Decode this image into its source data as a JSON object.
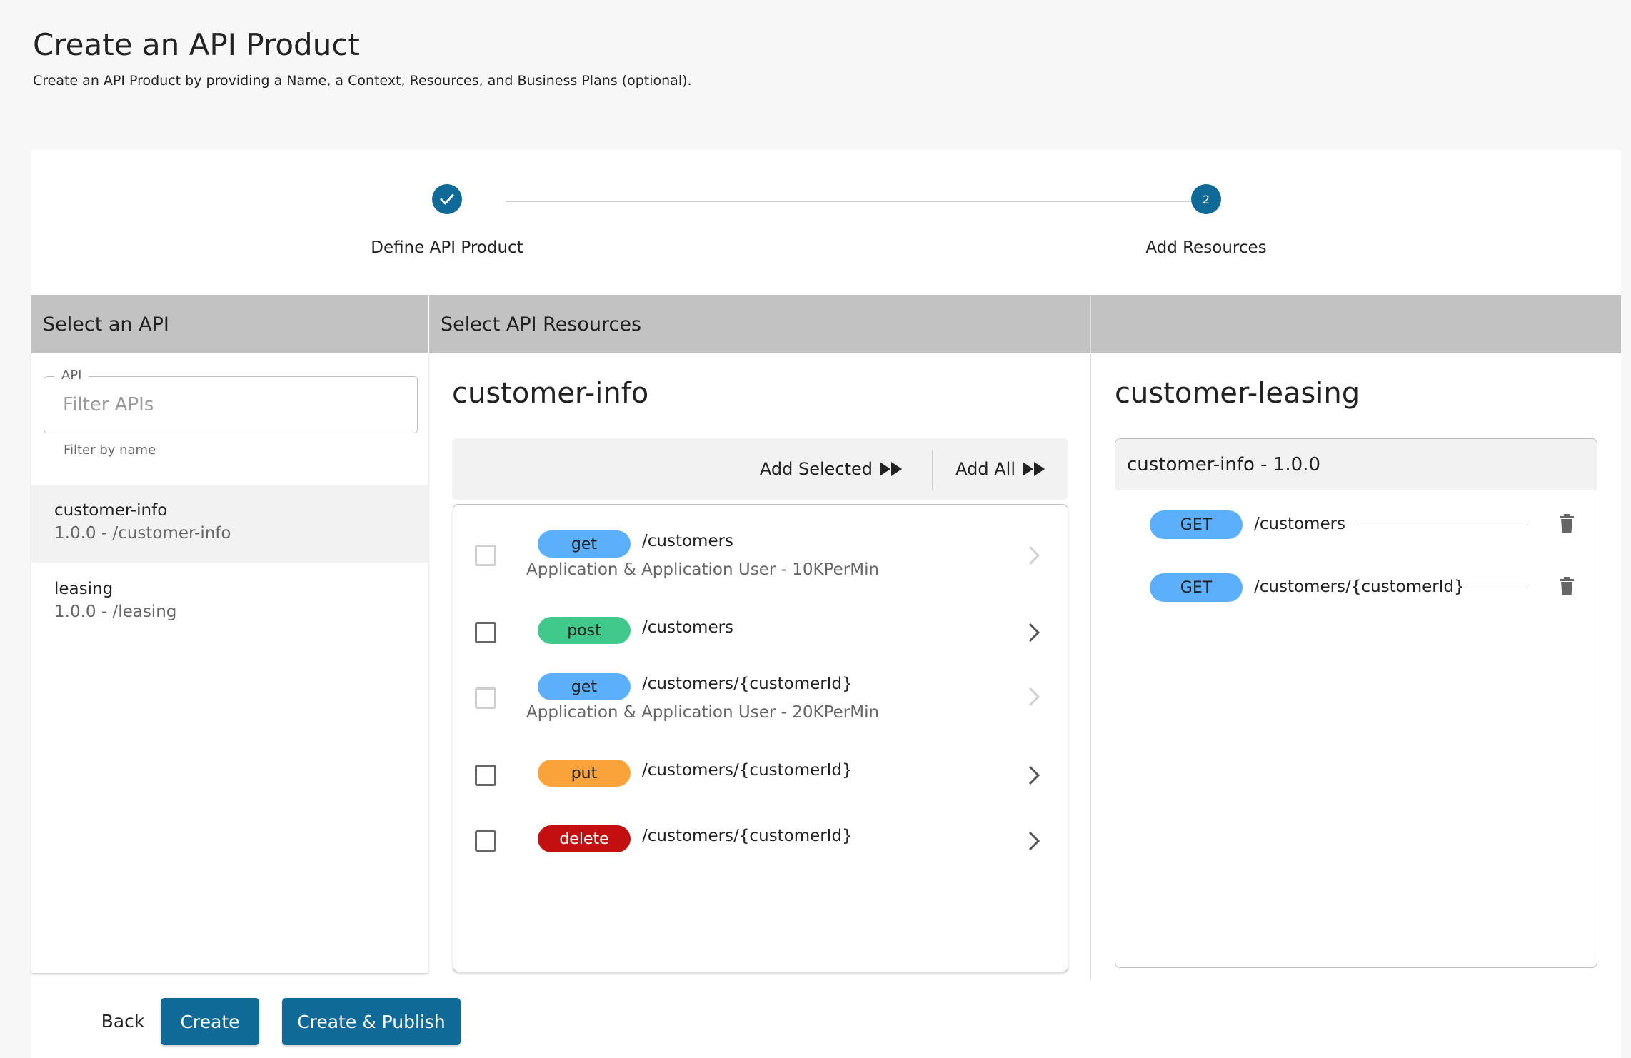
{
  "header": {
    "title": "Create an API Product",
    "subtitle": "Create an API Product by providing a Name, a Context, Resources, and Business Plans (optional)."
  },
  "stepper": {
    "steps": [
      {
        "label": "Define API Product",
        "status": "completed",
        "icon": "check-icon"
      },
      {
        "label": "Add Resources",
        "status": "active",
        "number": "2"
      }
    ]
  },
  "columns": {
    "select_api": "Select an API",
    "select_resources": "Select API Resources"
  },
  "api_filter": {
    "label": "API",
    "placeholder": "Filter APIs",
    "value": "",
    "helper": "Filter by name"
  },
  "apis": [
    {
      "name": "customer-info",
      "sub": "1.0.0 - /customer-info",
      "selected": true
    },
    {
      "name": "leasing",
      "sub": "1.0.0 - /leasing",
      "selected": false
    }
  ],
  "resources_panel": {
    "title": "customer-info",
    "add_selected_label": "Add Selected",
    "add_all_label": "Add All",
    "items": [
      {
        "method": "get",
        "path": "/customers",
        "sub": "Application & Application User - 10KPerMin",
        "disabled": true
      },
      {
        "method": "post",
        "path": "/customers",
        "sub": "",
        "disabled": false
      },
      {
        "method": "get",
        "path": "/customers/{customerId}",
        "sub": "Application & Application User - 20KPerMin",
        "disabled": true
      },
      {
        "method": "put",
        "path": "/customers/{customerId}",
        "sub": "",
        "disabled": false
      },
      {
        "method": "delete",
        "path": "/customers/{customerId}",
        "sub": "",
        "disabled": false
      }
    ]
  },
  "product_panel": {
    "title": "customer-leasing",
    "group_title": "customer-info - 1.0.0",
    "items": [
      {
        "method": "GET",
        "path": "/customers"
      },
      {
        "method": "GET",
        "path": "/customers/{customerId}"
      }
    ]
  },
  "footer": {
    "back_label": "Back",
    "create_label": "Create",
    "publish_label": "Create & Publish"
  },
  "colors": {
    "primary": "#0f6a97",
    "get": "#5caffb",
    "post": "#41c98c",
    "put": "#faa33a",
    "delete": "#c30f0f"
  }
}
